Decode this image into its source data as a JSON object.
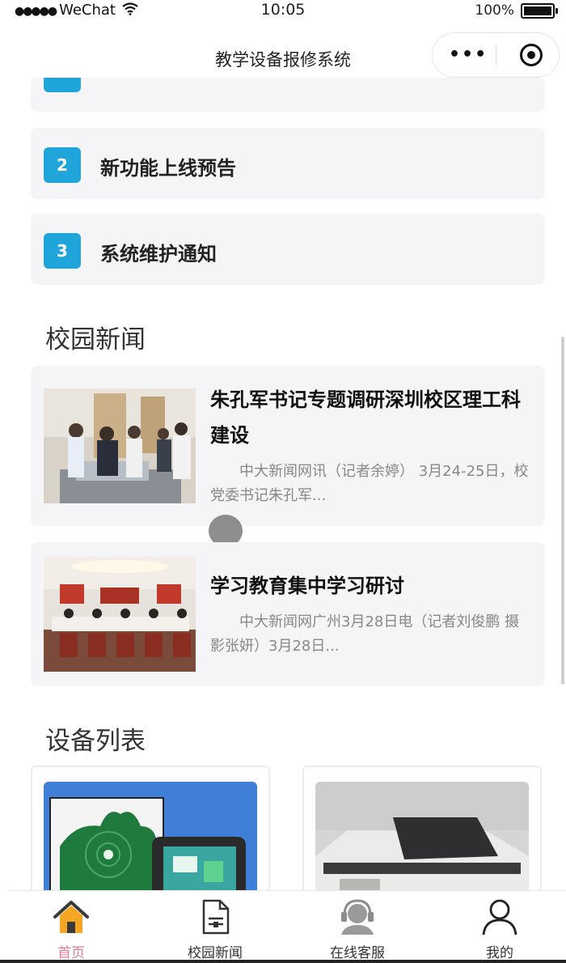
{
  "status_bar": {
    "signal": "●●●●●",
    "carrier": "WeChat",
    "time": "10:05",
    "battery": "100%"
  },
  "navbar": {
    "title": "教学设备报修系统",
    "more_icon": "more-icon",
    "close_icon": "target-icon"
  },
  "notices": [
    {
      "num": "2",
      "text": "新功能上线预告"
    },
    {
      "num": "3",
      "text": "系统维护通知"
    }
  ],
  "news_section": {
    "title": "校园新闻",
    "items": [
      {
        "title": "朱孔军书记专题调研深圳校区理工科建设",
        "summary": "中大新闻网讯（记者余婷） 3月24-25日，校党委书记朱孔军..."
      },
      {
        "title": "学习教育集中学习研讨",
        "summary": "中大新闻网广州3月28日电（记者刘俊鹏 摄影张妍）3月28日..."
      }
    ]
  },
  "device_section": {
    "title": "设备列表"
  },
  "tabbar": {
    "items": [
      {
        "label": "首页",
        "icon": "home-icon",
        "active": true
      },
      {
        "label": "校园新闻",
        "icon": "document-icon",
        "active": false
      },
      {
        "label": "在线客服",
        "icon": "customer-service-icon",
        "active": false
      },
      {
        "label": "我的",
        "icon": "user-icon",
        "active": false
      }
    ]
  },
  "colors": {
    "accent_badge": "#1fa5da",
    "tab_active": "#e8799a",
    "card_bg": "#f5f4f6",
    "home_icon": "#f5a623"
  }
}
